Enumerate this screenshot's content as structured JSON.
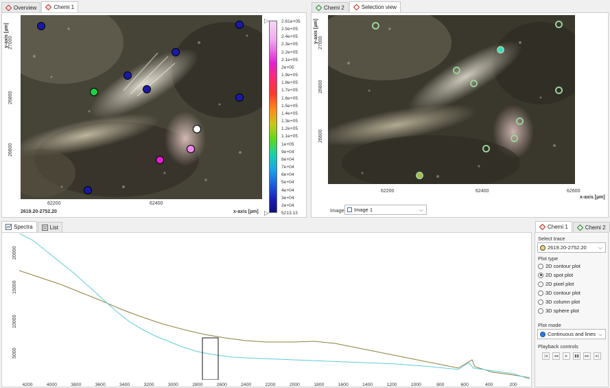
{
  "top_left": {
    "tabs": [
      {
        "label": "Overview"
      },
      {
        "label": "Chemi 1"
      }
    ],
    "y_axis_label": "y-axis [µm]",
    "y_ticks": [
      "27000",
      "26800",
      "26600"
    ],
    "x_ticks": [
      "62200",
      "62400"
    ],
    "x_axis_label": "x-axis [µm]",
    "corner_label": "2619.20-2752.20",
    "colorbar_labels": [
      "2.61e+05",
      "2.5e+05",
      "2.4e+05",
      "2.3e+05",
      "2.2e+05",
      "2.1e+05",
      "2e+05",
      "1.9e+05",
      "1.8e+05",
      "1.7e+05",
      "1.6e+05",
      "1.5e+05",
      "1.4e+05",
      "1.3e+05",
      "1.2e+05",
      "1.1e+05",
      "1e+05",
      "9e+04",
      "8e+04",
      "7e+04",
      "6e+04",
      "5e+04",
      "4e+04",
      "3e+04",
      "2e+04",
      "5213.13"
    ],
    "spot_colors": {
      "low": "#1a1aa8",
      "mid": "#22cc44",
      "high": "#e020d0",
      "top": "#ffffff"
    }
  },
  "top_right": {
    "tabs": [
      {
        "label": "Chemi 2"
      },
      {
        "label": "Selection view"
      }
    ],
    "y_axis_label": "y-axis [µm]",
    "y_ticks": [
      "27000",
      "26800",
      "26600"
    ],
    "x_ticks": [
      "62200",
      "62400",
      "62600"
    ],
    "x_axis_label": "x-axis [µm]",
    "image_label": "Image:",
    "image_value": "Image 1"
  },
  "bottom": {
    "tabs": [
      {
        "label": "Spectra"
      },
      {
        "label": "List"
      }
    ],
    "y_ticks": [
      "20000",
      "15000",
      "10000",
      "5000"
    ],
    "x_ticks": [
      "4200",
      "4000",
      "3800",
      "3600",
      "3400",
      "3200",
      "3000",
      "2800",
      "2600",
      "2400",
      "2200",
      "2000",
      "1800",
      "1600",
      "1400",
      "1200",
      "1000",
      "800",
      "600",
      "400",
      "200"
    ],
    "series_colors": {
      "a": "#5ecbd6",
      "b": "#8c7f3a"
    }
  },
  "side": {
    "tabs": [
      {
        "label": "Chemi 1"
      },
      {
        "label": "Chemi 2"
      }
    ],
    "select_trace_label": "Select trace",
    "trace_value": "2619.20-2752.20",
    "plot_type_label": "Plot type",
    "plot_types": [
      {
        "label": "2D contour plot",
        "selected": false
      },
      {
        "label": "2D spot plot",
        "selected": true
      },
      {
        "label": "2D pixel plot",
        "selected": false
      },
      {
        "label": "3D contour plot",
        "selected": false
      },
      {
        "label": "3D column plot",
        "selected": false
      },
      {
        "label": "3D sphere plot",
        "selected": false
      }
    ],
    "plot_mode_label": "Plot mode",
    "plot_mode_value": "Continuous and lines",
    "playback_label": "Playback controls"
  }
}
